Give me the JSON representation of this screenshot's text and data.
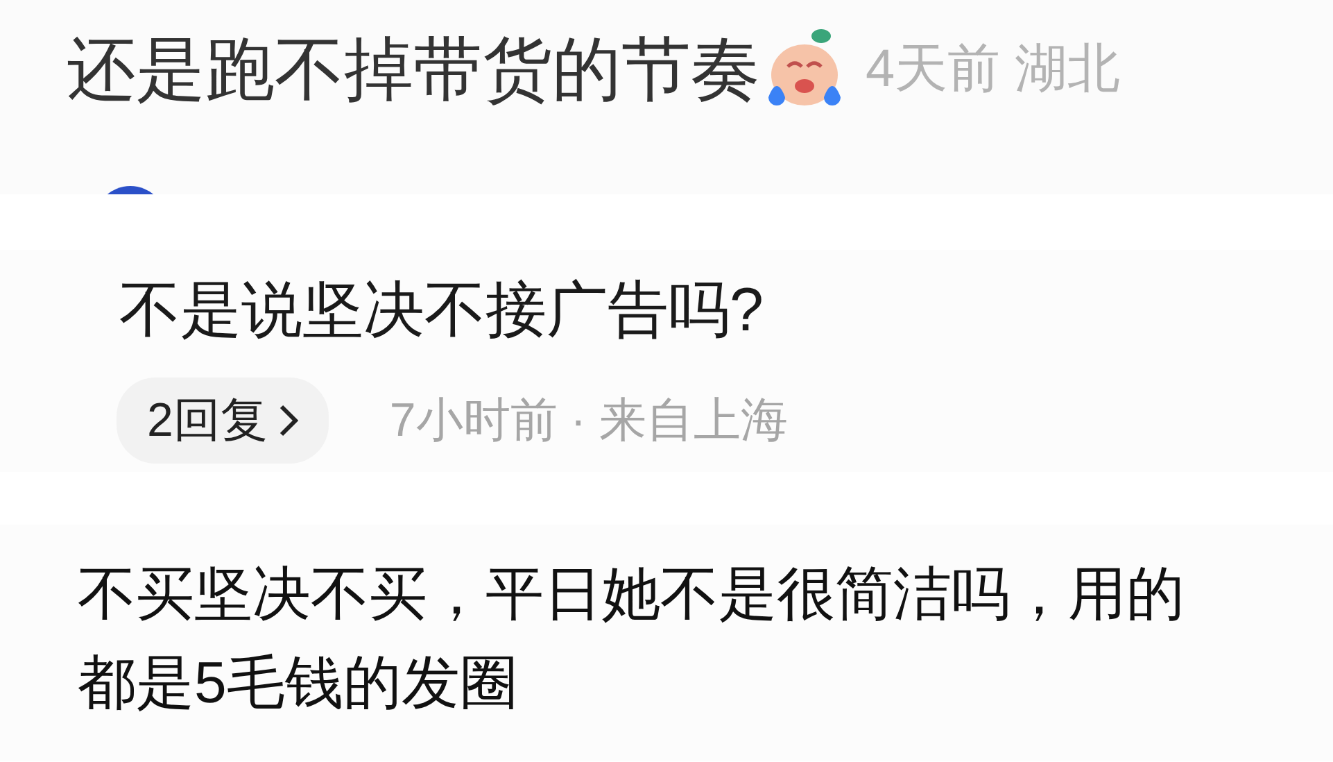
{
  "comments": [
    {
      "kind": "comment",
      "text": "还是跑不掉带货的节奏",
      "time": "4天前",
      "location": "湖北"
    },
    {
      "kind": "reply",
      "text": "不是说坚决不接广告吗?",
      "replies_button": "2回复",
      "time": "7小时前",
      "separator": "·",
      "location": "来自上海"
    },
    {
      "kind": "text",
      "text": "不买坚决不买，平日她不是很简洁吗，用的都是5毛钱的发圈"
    }
  ]
}
